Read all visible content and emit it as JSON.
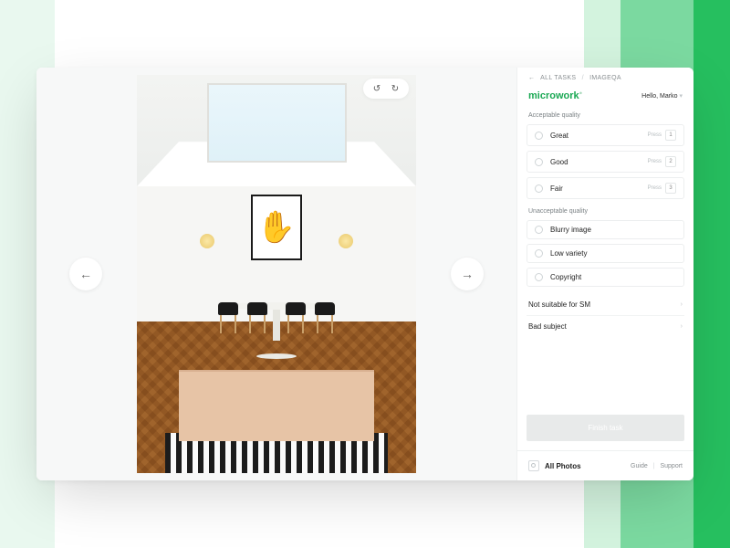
{
  "breadcrumbs": {
    "back": "ALL TASKS",
    "current": "IMAGEQA"
  },
  "brand": "microwork",
  "greeting": {
    "prefix": "Hello,",
    "name": "Marko"
  },
  "acceptable": {
    "title": "Acceptable quality",
    "options": [
      {
        "label": "Great",
        "hint": "Press",
        "key": "1"
      },
      {
        "label": "Good",
        "hint": "Press",
        "key": "2"
      },
      {
        "label": "Fair",
        "hint": "Press",
        "key": "3"
      }
    ]
  },
  "unacceptable": {
    "title": "Unacceptable quality",
    "options": [
      {
        "label": "Blurry image"
      },
      {
        "label": "Low variety"
      },
      {
        "label": "Copyright"
      }
    ]
  },
  "expanders": [
    {
      "label": "Not suitable for SM"
    },
    {
      "label": "Bad subject"
    }
  ],
  "finish_label": "Finish task",
  "footer": {
    "all_photos": "All Photos",
    "guide": "Guide",
    "support": "Support"
  }
}
